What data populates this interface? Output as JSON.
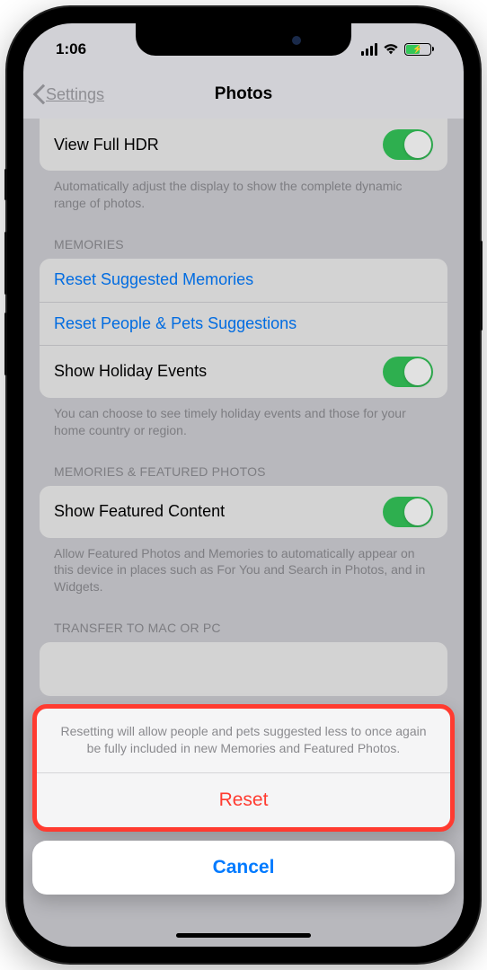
{
  "statusbar": {
    "time": "1:06"
  },
  "nav": {
    "back_label": "Settings",
    "title": "Photos"
  },
  "rows": {
    "view_full_hdr_label": "View Full HDR",
    "hdr_footer": "Automatically adjust the display to show the complete dynamic range of photos.",
    "memories_header": "MEMORIES",
    "reset_memories_label": "Reset Suggested Memories",
    "reset_people_label": "Reset People & Pets Suggestions",
    "holiday_label": "Show Holiday Events",
    "holiday_footer": "You can choose to see timely holiday events and those for your home country or region.",
    "featured_header": "MEMORIES & FEATURED PHOTOS",
    "featured_label": "Show Featured Content",
    "featured_footer": "Allow Featured Photos and Memories to automatically appear on this device in places such as For You and Search in Photos, and in Widgets.",
    "transfer_header": "TRANSFER TO MAC OR PC"
  },
  "sheet": {
    "message": "Resetting will allow people and pets suggested less to once again be fully included in new Memories and Featured Photos.",
    "reset_label": "Reset",
    "cancel_label": "Cancel"
  }
}
